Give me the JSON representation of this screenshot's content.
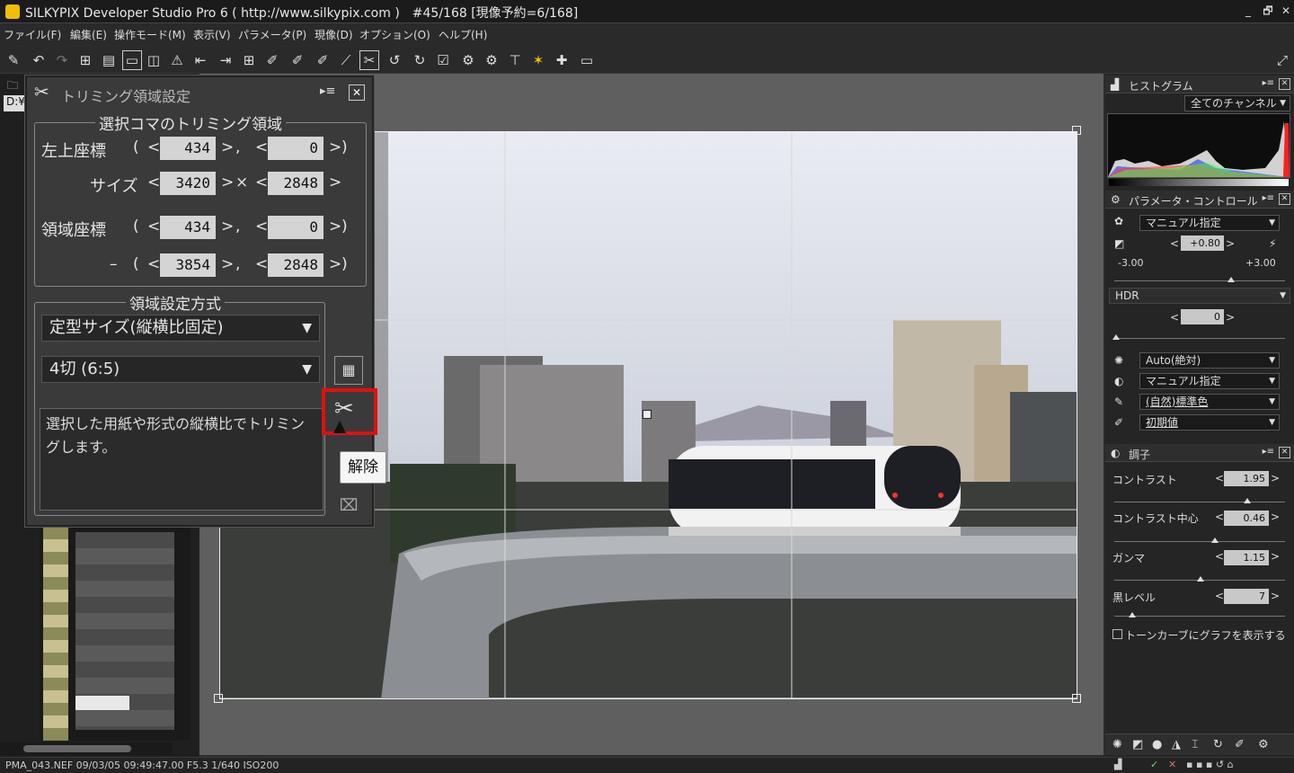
{
  "window": {
    "title": "SILKYPIX Developer Studio Pro 6 ( http://www.silkypix.com )　#45/168 [現像予約=6/168]",
    "min": "_",
    "restore": "🗗",
    "close": "✕"
  },
  "menu": [
    "ファイル(F)",
    "編集(E)",
    "操作モード(M)",
    "表示(V)",
    "パラメータ(P)",
    "現像(D)",
    "オプション(O)",
    "ヘルプ(H)"
  ],
  "left": {
    "path_prefix": "D:¥"
  },
  "dialog": {
    "title": "トリミング領域設定",
    "group1_title": "選択コマのトリミング領域",
    "top_left_label": "左上座標",
    "top_left": [
      "434",
      "0"
    ],
    "size_label": "サイズ",
    "size": [
      "3420",
      "2848"
    ],
    "area_label": "領域座標",
    "area_start": [
      "434",
      "0"
    ],
    "area_end": [
      "3854",
      "2848"
    ],
    "group2_title": "領域設定方式",
    "method": "定型サイズ(縦横比固定)",
    "ratio": "4切 (6:5)",
    "description": "選択した用紙や形式の縦横比でトリミングします。",
    "tooltip": "解除",
    "open_paren": "(",
    "close_paren": ")",
    "comma": ",",
    "times": "×",
    "dash": "–",
    "lt": "<",
    "gt": ">"
  },
  "right": {
    "histogram": {
      "title": "ヒストグラム",
      "channel": "全てのチャンネル"
    },
    "param_control": {
      "title": "パラメータ・コントロール",
      "wb_mode": "マニュアル指定",
      "exposure": "+0.80",
      "exp_min": "-3.00",
      "exp_max": "+3.00",
      "hdr_label": "HDR",
      "hdr_value": "0",
      "taste1": "Auto(絶対)",
      "taste2": "マニュアル指定",
      "taste3": "(自然)標準色",
      "taste4": "初期値"
    },
    "tone": {
      "title": "調子",
      "contrast_label": "コントラスト",
      "contrast": "1.95",
      "contrast_center_label": "コントラスト中心",
      "contrast_center": "0.46",
      "gamma_label": "ガンマ",
      "gamma": "1.15",
      "black_label": "黒レベル",
      "black": "7",
      "tonecurve_label": "トーンカーブにグラフを表示する"
    }
  },
  "status": {
    "text": "PMA_043.NEF 09/03/05 09:49:47.00 F5.3 1/640 ISO200"
  },
  "colors": {
    "highlight": "#e01010",
    "bg": "#2b2b2b"
  }
}
